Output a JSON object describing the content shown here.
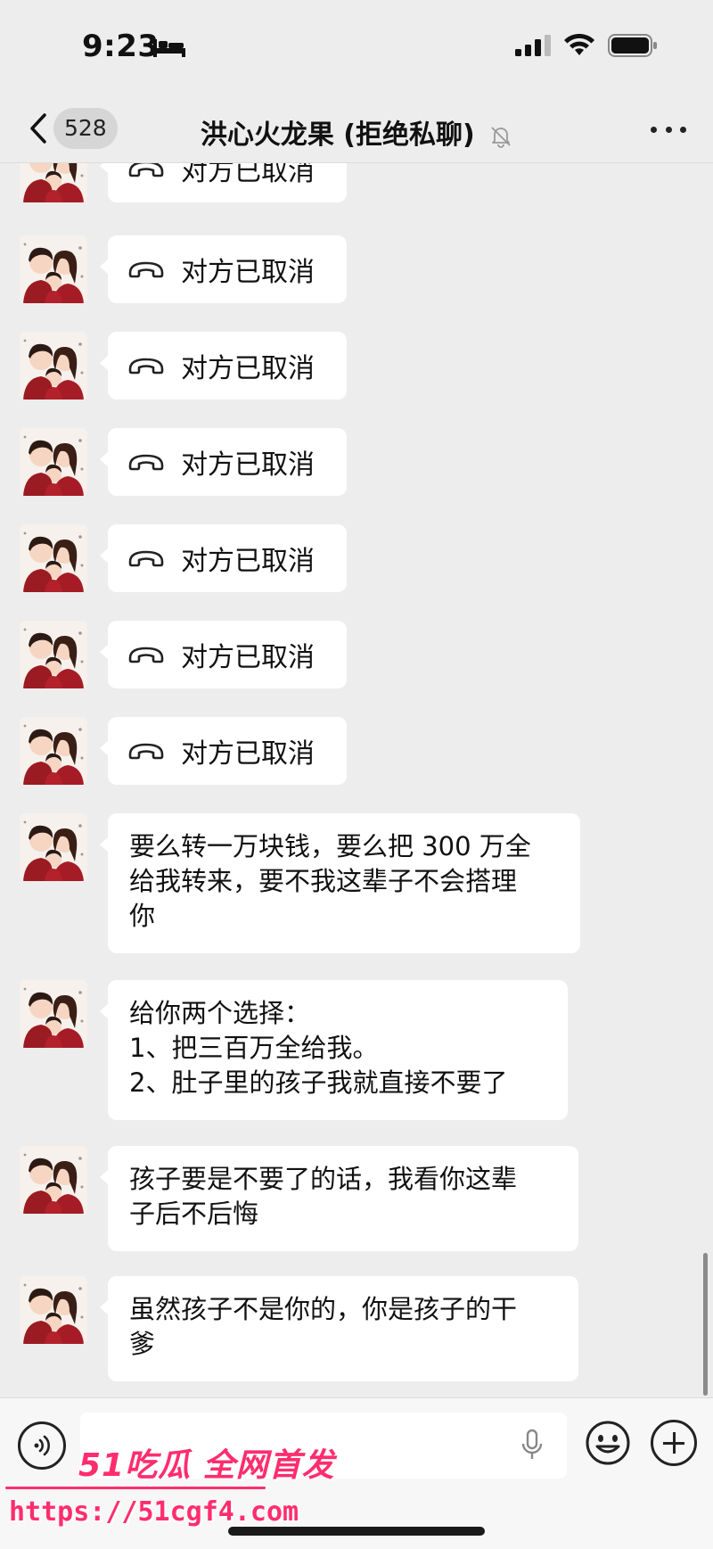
{
  "status": {
    "time": "9:23"
  },
  "header": {
    "back_count": "528",
    "title": "洪心火龙果 (拒绝私聊)"
  },
  "messages": [
    {
      "type": "call",
      "text": "对方已取消"
    },
    {
      "type": "call",
      "text": "对方已取消"
    },
    {
      "type": "call",
      "text": "对方已取消"
    },
    {
      "type": "call",
      "text": "对方已取消"
    },
    {
      "type": "call",
      "text": "对方已取消"
    },
    {
      "type": "call",
      "text": "对方已取消"
    },
    {
      "type": "call",
      "text": "对方已取消"
    },
    {
      "type": "text",
      "text": "要么转一万块钱，要么把 300 万全\n给我转来，要不我这辈子不会搭理\n你"
    },
    {
      "type": "text",
      "text": "给你两个选择：\n1、把三百万全给我。\n2、肚子里的孩子我就直接不要了"
    },
    {
      "type": "text",
      "text": "孩子要是不要了的话，我看你这辈\n子后不后悔"
    },
    {
      "type": "text",
      "text": "虽然孩子不是你的，你是孩子的干\n爹"
    }
  ],
  "watermark": {
    "brand": "51吃瓜 全网首发",
    "url": "https://51cgf4.com"
  },
  "colors": {
    "background": "#ededed",
    "bubble": "#ffffff",
    "watermark": "#ff2d6e"
  }
}
